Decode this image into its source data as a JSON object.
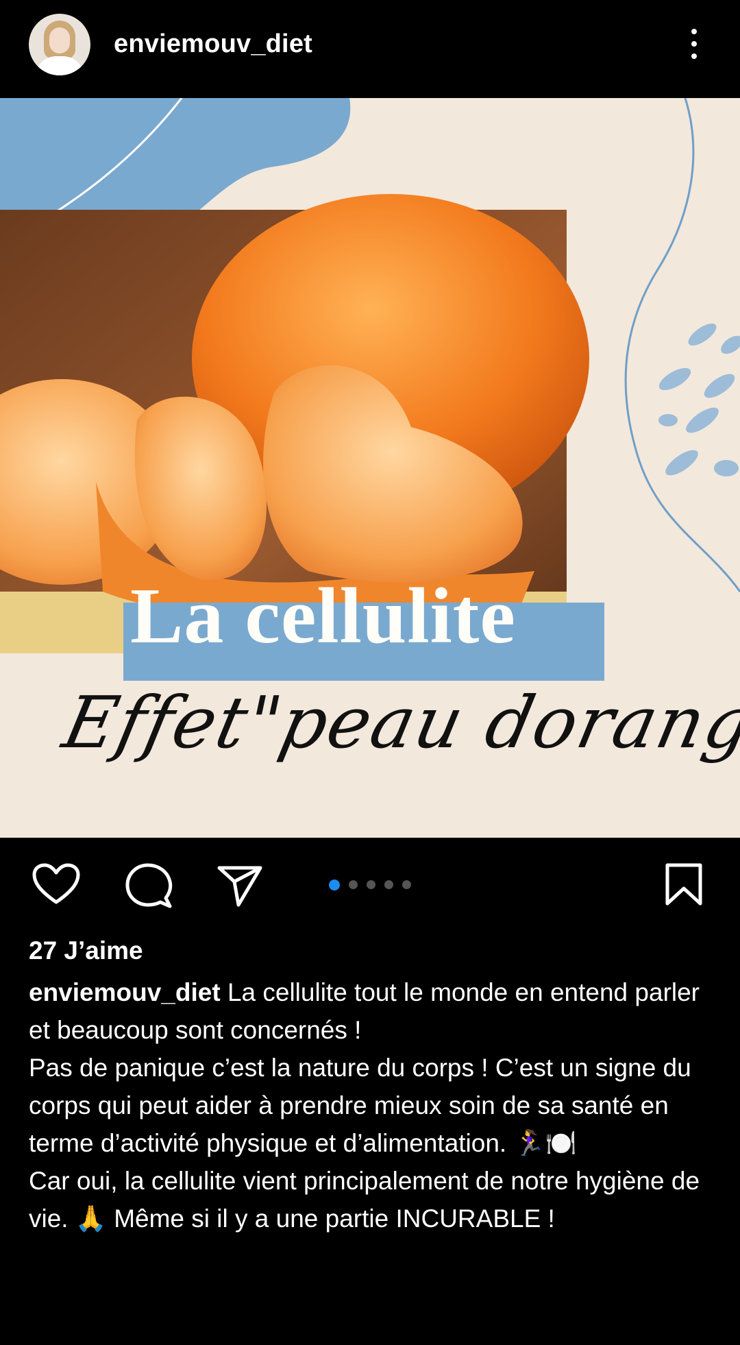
{
  "header": {
    "username": "enviemouv_diet",
    "avatar_icon": "profile-avatar",
    "menu_icon": "more-vertical-icon"
  },
  "post": {
    "title": "La cellulite",
    "subtitle": "Effet\"peau dorange\"",
    "colors": {
      "background": "#f2e8dc",
      "accent_blue": "#7aa9cf",
      "orange": "#f08a2b"
    }
  },
  "actions": {
    "icons": [
      "heart-icon",
      "comment-icon",
      "share-icon",
      "bookmark-icon"
    ],
    "carousel": {
      "total": 5,
      "current": 1
    }
  },
  "likes": "27 J’aime",
  "caption": {
    "username": "enviemouv_diet",
    "line1": "La cellulite tout le monde en entend parler et beaucoup sont concernés !",
    "line2": "Pas de panique c’est la nature du corps ! C’est un signe du corps qui peut aider à prendre mieux soin de sa santé en terme d’activité physique et d’alimentation.  🏃‍♀️🍽️",
    "line3": "Car oui, la cellulite vient principalement de notre hygiène de vie. 🙏 Même si il y a une partie INCURABLE !"
  }
}
